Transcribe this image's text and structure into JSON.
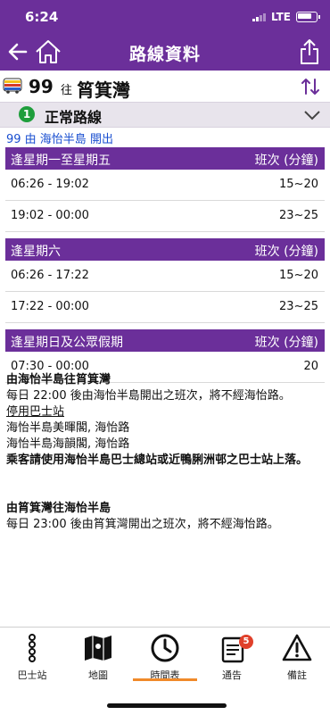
{
  "status_bar": {
    "time": "6:24",
    "network": "LTE"
  },
  "nav": {
    "title": "路線資料"
  },
  "route": {
    "number": "99",
    "to_label": "往",
    "destination": "筲箕灣"
  },
  "service": {
    "index": "1",
    "label": "正常路線"
  },
  "departure_note": "99 由 海怡半島 開出",
  "schedules": [
    {
      "heading": "逢星期一至星期五",
      "freq_header": "班次 (分鐘)",
      "rows": [
        {
          "period": "06:26 - 19:02",
          "freq": "15~20"
        },
        {
          "period": "19:02 - 00:00",
          "freq": "23~25"
        }
      ]
    },
    {
      "heading": "逢星期六",
      "freq_header": "班次 (分鐘)",
      "rows": [
        {
          "period": "06:26 - 17:22",
          "freq": "15~20"
        },
        {
          "period": "17:22 - 00:00",
          "freq": "23~25"
        }
      ]
    },
    {
      "heading": "逢星期日及公眾假期",
      "freq_header": "班次 (分鐘)",
      "rows": [
        {
          "period": "07:30 - 00:00",
          "freq": "20"
        }
      ]
    }
  ],
  "notes": {
    "block1_title": "由海怡半島往筲箕灣",
    "block1_line1": "每日 22:00 後由海怡半島開出之班次，將不經海怡路。",
    "block1_link": "停用巴士站",
    "block1_stop1": "海怡半島美暉閣, 海怡路",
    "block1_stop2": "海怡半島海韻閣, 海怡路",
    "block1_bold": "乘客請使用海怡半島巴士總站或近鴨脷洲邨之巴士站上落。",
    "block2_title": "由筲箕灣往海怡半島",
    "block2_line1": "每日 23:00 後由筲箕灣開出之班次，將不經海怡路。"
  },
  "tabs": {
    "bus_stop": "巴士站",
    "map": "地圖",
    "timetable": "時間表",
    "notices": "通告",
    "remarks": "備註",
    "notices_badge": "5"
  },
  "colors": {
    "header": "#6b2f9a",
    "active_tab": "#f08a2a",
    "link": "#1a4fd0",
    "badge": "#e0402a"
  }
}
